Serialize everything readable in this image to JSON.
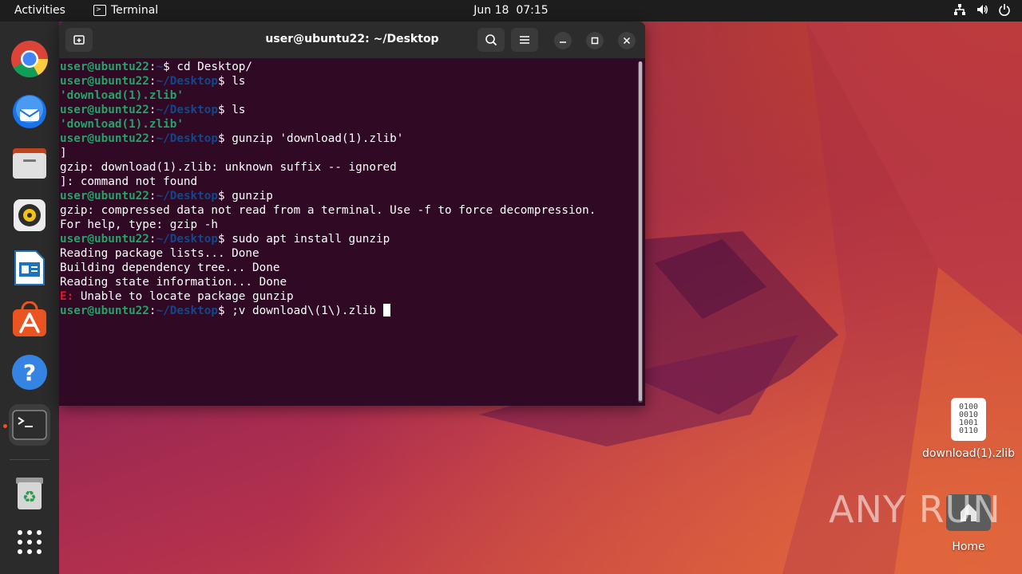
{
  "topbar": {
    "activities": "Activities",
    "app_name": "Terminal",
    "date": "Jun 18",
    "time": "07:15"
  },
  "dock": {
    "items": [
      "chrome-icon",
      "thunderbird-icon",
      "files-icon",
      "rhythmbox-icon",
      "libreoffice-writer-icon",
      "app-center-icon",
      "help-icon",
      "terminal-icon",
      "trash-icon",
      "show-apps-icon"
    ]
  },
  "terminal": {
    "title": "user@ubuntu22: ~/Desktop",
    "user": "user@ubuntu22",
    "colon": ":",
    "home_path": "~",
    "desktop_path": "~/Desktop",
    "dollar": "$",
    "cmd1": " cd Desktop/",
    "cmd2": " ls",
    "out2": "'download(1).zlib'",
    "cmd3": " ls",
    "out3": "'download(1).zlib'",
    "cmd4": " gunzip 'download(1).zlib'",
    "out4a": "]",
    "out4b": "gzip: download(1).zlib: unknown suffix -- ignored",
    "out4c": "]: command not found",
    "cmd5": " gunzip",
    "out5a": "gzip: compressed data not read from a terminal. Use -f to force decompression.",
    "out5b": "For help, type: gzip -h",
    "cmd6": " sudo apt install gunzip",
    "out6a": "Reading package lists... Done",
    "out6b": "Building dependency tree... Done",
    "out6c": "Reading state information... Done",
    "err_prefix": "E:",
    "out6d": " Unable to locate package gunzip",
    "cmd7": " ;v download\\(1\\).zlib "
  },
  "desktop": {
    "file_label": "download(1).zlib",
    "file_glyph": [
      "0100",
      "0010",
      "1001",
      "0110"
    ],
    "home_label": "Home"
  },
  "watermark": "ANY RUN"
}
